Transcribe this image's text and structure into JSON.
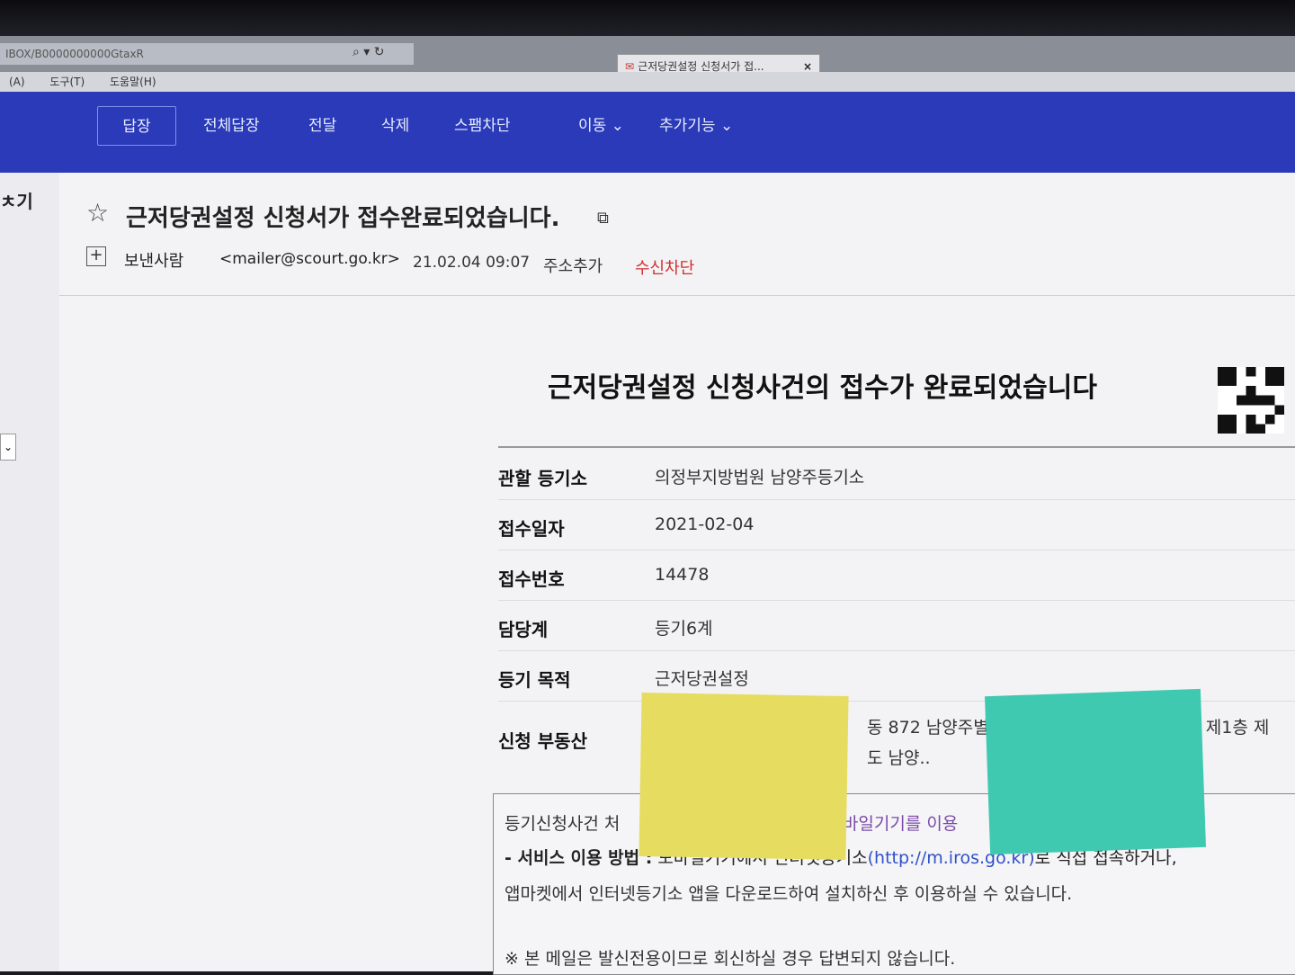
{
  "browser": {
    "url": "IBOX/B0000000000GtaxR",
    "tab_title": "근저당권설정 신청서가 접...",
    "tab_close": "×",
    "menu": [
      "(A)",
      "도구(T)",
      "도움말(H)"
    ]
  },
  "toolbar": {
    "reply": "답장",
    "reply_all": "전체답장",
    "forward": "전달",
    "delete": "삭제",
    "spam_block": "스팸차단",
    "move": "이동 ⌄",
    "more": "추가기능 ⌄"
  },
  "sidebar": {
    "partial_label": "ㅊ기",
    "select": "⌄"
  },
  "mail": {
    "subject": "근저당권설정 신청서가 접수완료되었습니다.",
    "sender_label": "보낸사람",
    "sender_email": "<mailer@scourt.go.kr>",
    "date": "21.02.04 09:07",
    "add_address": "주소추가",
    "block_sender": "수신차단"
  },
  "body": {
    "title": "근저당권설정 신청사건의 접수가 완료되었습니다",
    "rows": [
      {
        "label": "관할 등기소",
        "value": "의정부지방법원 남양주등기소"
      },
      {
        "label": "접수일자",
        "value": "2021-02-04"
      },
      {
        "label": "접수번호",
        "value": "14478"
      },
      {
        "label": "담당계",
        "value": "등기6계"
      },
      {
        "label": "등기 목적",
        "value": "근저당권설정"
      }
    ],
    "property_label": "신청 부동산",
    "property_line1": "동 872 남양주별",
    "property_line1b": "가동 제1층 제",
    "property_line2": "도 남양..",
    "notice_line1a": "등기신청사건 처",
    "notice_line1b": "모바일기기를 이용",
    "notice_service_label": "- 서비스 이용 방법 :",
    "notice_service_text": "모바일기기에서 인터넷등기소",
    "notice_link": "(http://m.iros.go.kr)",
    "notice_service_tail": "로 직접 접속하거나,",
    "notice_line3": "앱마켓에서 인터넷등기소 앱을 다운로드하여 설치하신 후 이용하실 수 있습니다.",
    "notice_line4": "※ 본 메일은 발신전용이므로 회신하실 경우 답변되지 않습니다."
  },
  "colors": {
    "toolbar_bg": "#2a3ab8",
    "block_red": "#d03030",
    "link_blue": "#3050c8",
    "note_yellow": "#e6dc60",
    "note_teal": "#3fc9b0"
  }
}
